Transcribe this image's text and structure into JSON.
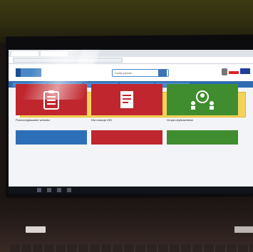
{
  "browser": {
    "tabs": [
      "",
      ""
    ]
  },
  "site": {
    "search_placeholder": "Zadaj pytanie",
    "nav_items": [
      "",
      "",
      "",
      "",
      ""
    ],
    "notice": "",
    "tiles": [
      {
        "label": "Pomoc/zgłaszanie wniosku",
        "icon": "clipboard-icon",
        "color": "#c0262d"
      },
      {
        "label": "Dla rozwoju IOD",
        "icon": "document-icon",
        "color": "#c0262d"
      },
      {
        "label": "Grupa użytkowników",
        "icon": "people-network-icon",
        "color": "#3f8d2e"
      }
    ]
  }
}
